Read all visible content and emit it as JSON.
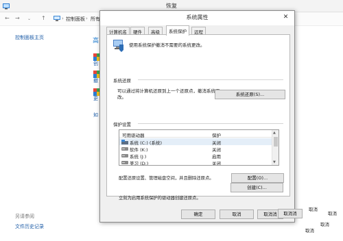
{
  "background_window": {
    "title": "恢复",
    "address": {
      "crumb1": "控制面板",
      "sep1": "›",
      "crumb2": "所有",
      "sep2": "›"
    },
    "sidebar": {
      "home_link": "控制面板主页",
      "see_also": "另请参阅",
      "file_history": "文件历史记录"
    },
    "content": {
      "heading_clip": "高",
      "item1_clip": "创",
      "item2_clip": "撤",
      "item3_clip": "更",
      "link_clip": "如"
    }
  },
  "dialog": {
    "title": "系统属性",
    "close_glyph": "✕",
    "tabs": [
      "计算机名",
      "硬件",
      "高级",
      "系统保护",
      "远程"
    ],
    "active_tab": "系统保护",
    "intro_text": "使用系统保护撤消不需要的系统更改。",
    "system_restore": {
      "group_label": "系统还原",
      "description": "可以通过将计算机还原到上一个还原点，撤消系统更改。",
      "button": "系统还原(S)..."
    },
    "protection_settings": {
      "group_label": "保护设置",
      "columns": {
        "drive": "可用驱动器",
        "protection": "保护"
      },
      "rows": [
        {
          "drive": "系统 (C:) (系统)",
          "protection": "关闭"
        },
        {
          "drive": "软件 (K:)",
          "protection": "关闭"
        },
        {
          "drive": "系统 (J:)",
          "protection": "启用"
        },
        {
          "drive": "美习 (D:)",
          "protection": "关闭"
        }
      ],
      "configure_text": "配置还原设置、管理磁盘空间，并且删除还原点。",
      "configure_button": "配置(O)...",
      "create_text": "立刻为启用系统保护的驱动器创建还原点。",
      "create_button": "创建(C)..."
    },
    "footer": {
      "ok": "确定",
      "cancel": "取消",
      "cancel_dup1": "取消消",
      "cancel_dup2": "取消消"
    }
  },
  "stray_text": {
    "a": "取消",
    "b": "取消",
    "c": "取消",
    "d": "取消"
  },
  "colors": {
    "link": "#1a5aa6",
    "dialog_bg": "#f0f0f0",
    "selection": "#e4eef8"
  }
}
